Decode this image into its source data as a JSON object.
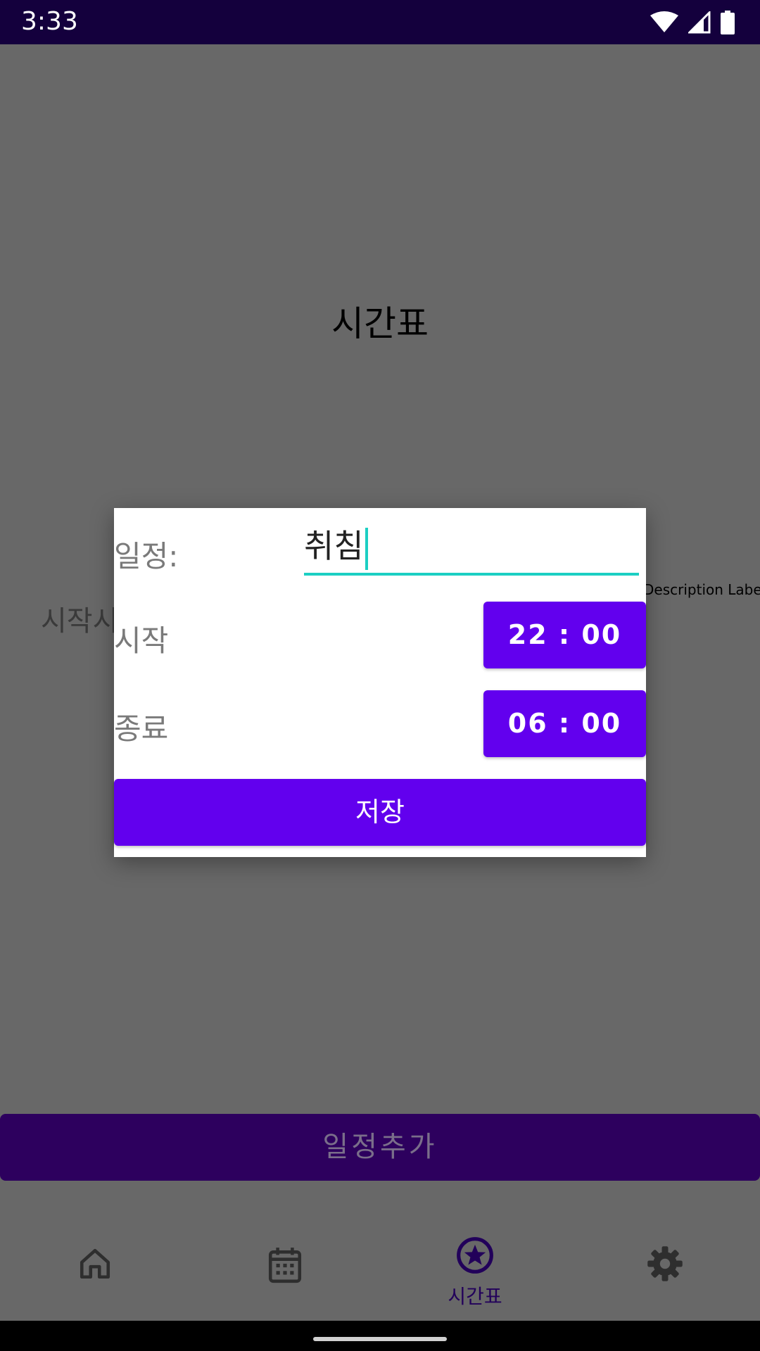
{
  "status_bar": {
    "time": "3:33"
  },
  "screen": {
    "title": "시간표",
    "start_label": "시작시",
    "description_label": "Description Label",
    "add_button": "일정추가"
  },
  "dialog": {
    "schedule_label": "일정:",
    "schedule_value": "취침",
    "start_label": "시작",
    "start_time": "22 : 00",
    "end_label": "종료",
    "end_time": "06 : 00",
    "save_button": "저장"
  },
  "bottom_nav": {
    "items": [
      {
        "icon": "home-icon",
        "label": ""
      },
      {
        "icon": "calendar-icon",
        "label": ""
      },
      {
        "icon": "star-circle-icon",
        "label": "시간표",
        "selected": true
      },
      {
        "icon": "gear-icon",
        "label": ""
      }
    ]
  },
  "colors": {
    "accent": "#6200ee",
    "input_underline": "#1ccfc3",
    "status_bar": "#14003d",
    "scrim": "#686868"
  }
}
